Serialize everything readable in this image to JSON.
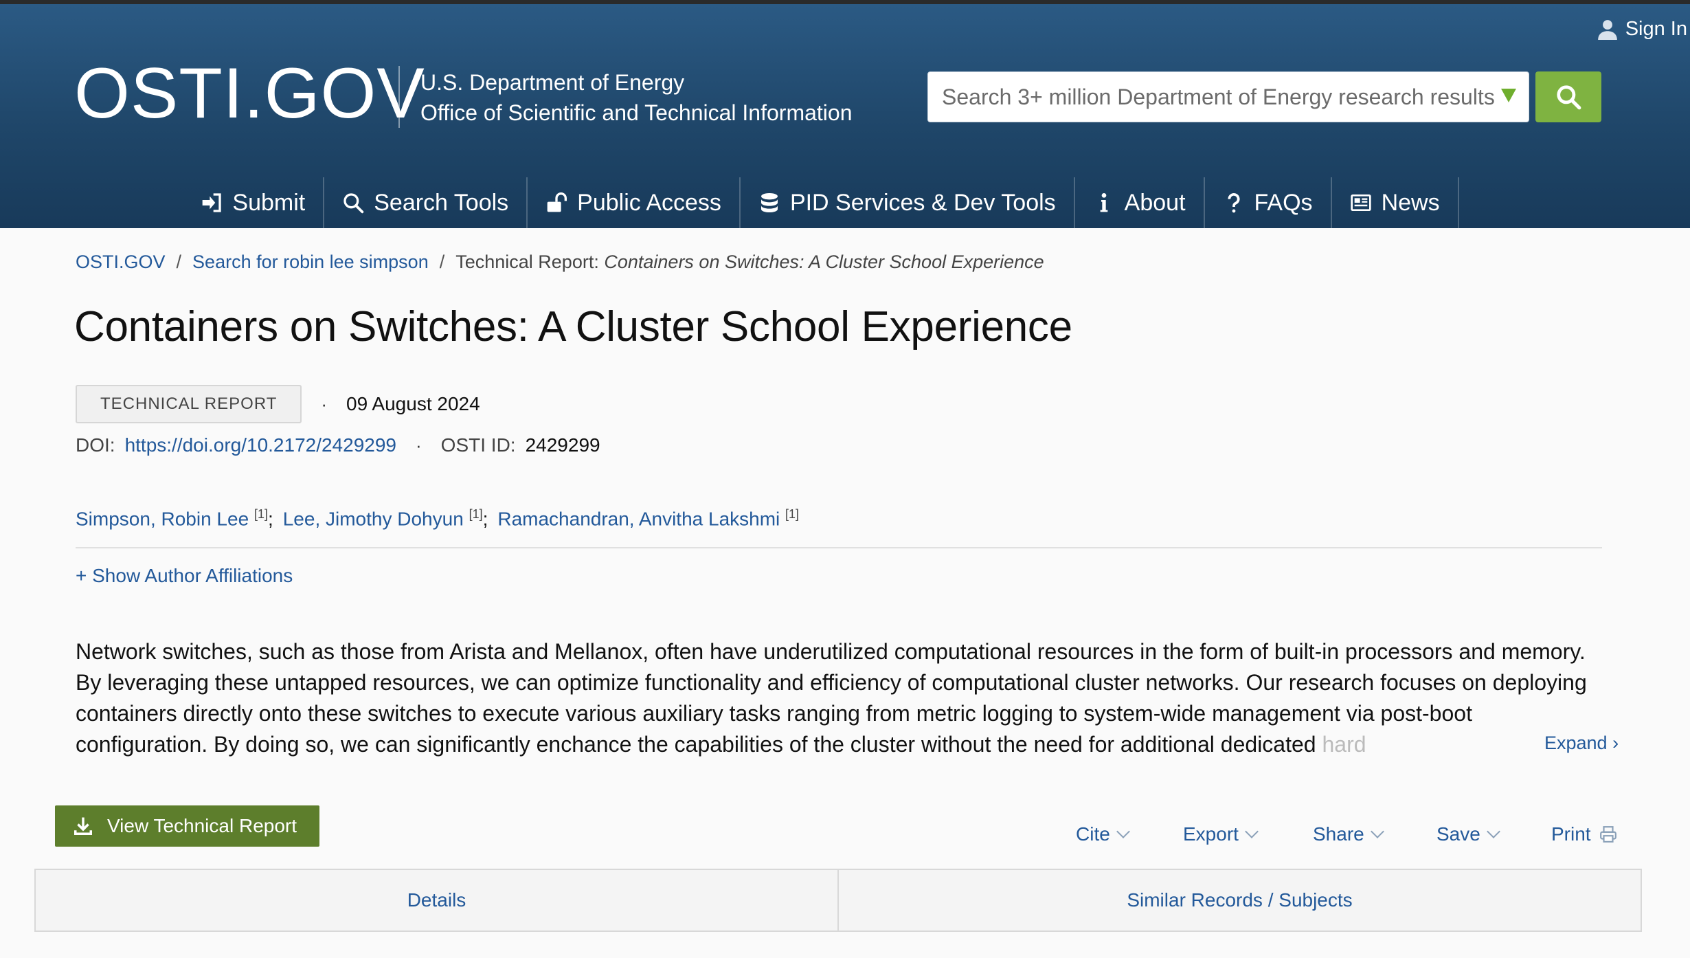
{
  "header": {
    "sign_in": "Sign In",
    "logo_main": "OSTI",
    "logo_dot": ".",
    "logo_tld": "GOV",
    "agency_line1": "U.S. Department of Energy",
    "agency_line2": "Office of Scientific and Technical Information",
    "search_placeholder": "Search 3+ million Department of Energy research results",
    "accent_color": "#7fb341"
  },
  "nav": [
    {
      "label": "Submit",
      "icon": "sign-in-icon"
    },
    {
      "label": "Search Tools",
      "icon": "search-icon"
    },
    {
      "label": "Public Access",
      "icon": "unlock-icon"
    },
    {
      "label": "PID Services & Dev Tools",
      "icon": "database-icon"
    },
    {
      "label": "About",
      "icon": "info-icon"
    },
    {
      "label": "FAQs",
      "icon": "question-icon"
    },
    {
      "label": "News",
      "icon": "newspaper-icon"
    }
  ],
  "breadcrumb": {
    "home": "OSTI.GOV",
    "sep": "/",
    "search": "Search for robin lee simpson",
    "current_prefix": "Technical Report:",
    "current_title": "Containers on Switches: A Cluster School Experience"
  },
  "record": {
    "title": "Containers on Switches: A Cluster School Experience",
    "type": "TECHNICAL REPORT",
    "dot": "·",
    "date": "09 August 2024",
    "doi_label": "DOI:",
    "doi": "https://doi.org/10.2172/2429299",
    "osti_id_label": "OSTI ID:",
    "osti_id": "2429299",
    "authors": [
      {
        "name": "Simpson, Robin Lee",
        "aff": "[1]",
        "sep": ";"
      },
      {
        "name": "Lee, Jimothy Dohyun",
        "aff": "[1]",
        "sep": ";"
      },
      {
        "name": "Ramachandran, Anvitha Lakshmi",
        "aff": "[1]",
        "sep": ""
      }
    ],
    "show_affiliations": "+ Show Author Affiliations",
    "abstract": "Network switches, such as those from Arista and Mellanox, often have underutilized computational resources in the form of built-in processors and memory. By leveraging these untapped resources, we can optimize functionality and efficiency of computational cluster networks. Our research focuses on deploying containers directly onto these switches to execute various auxiliary tasks ranging from metric logging to system-wide management via post-boot configuration. By doing so, we can significantly enchance the capabilities of the cluster without the need for additional dedicated",
    "abstract_fade": "hard",
    "expand": "Expand ›"
  },
  "actions": {
    "view_report": "View Technical Report",
    "cite": "Cite",
    "export": "Export",
    "share": "Share",
    "save": "Save",
    "print": "Print"
  },
  "tabs": [
    "Details",
    "Similar Records / Subjects"
  ]
}
